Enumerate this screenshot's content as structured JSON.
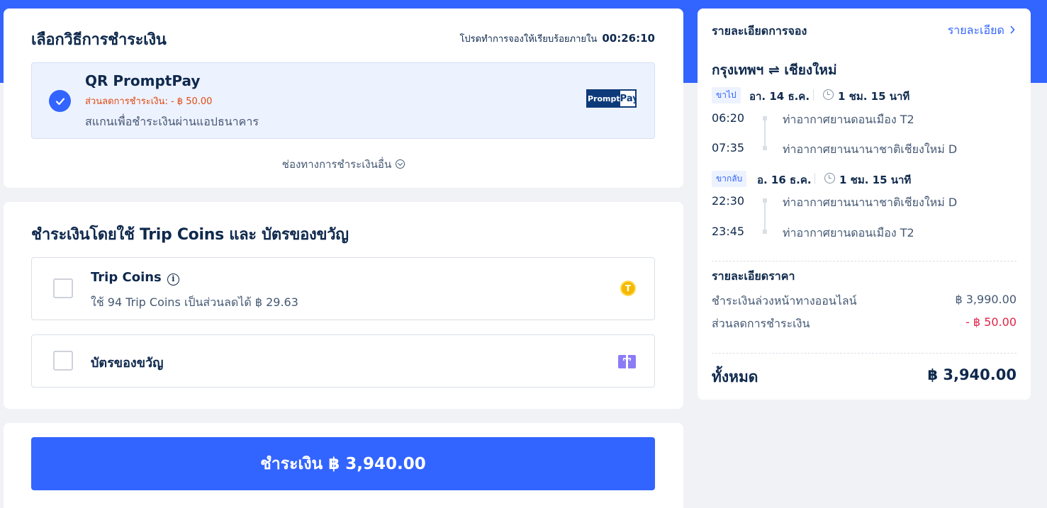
{
  "payment_section": {
    "title": "เลือกวิธีการชำระเงิน",
    "timer_text": "โปรดทำการจองให้เรียบร้อยภายใน",
    "timer_value": "00:26:10",
    "selected_method": {
      "name": "QR PromptPay",
      "discount": "ส่วนลดการชำระเงิน: - ฿ 50.00",
      "description": "สแกนเพื่อชำระเงินผ่านแอปธนาคาร",
      "logo_text_a": "Prompt",
      "logo_text_b": "Pay"
    },
    "more_methods_label": "ช่องทางการชำระเงินอื่น"
  },
  "coins_section": {
    "title": "ชำระเงินโดยใช้ Trip Coins และ บัตรของขวัญ",
    "trip_coins": {
      "title": "Trip Coins",
      "info_glyph": "i",
      "subtitle": "ใช้ 94 Trip Coins เป็นส่วนลดได้ ฿ 29.63",
      "coin_glyph": "T"
    },
    "gift_card": {
      "title": "บัตรของขวัญ"
    }
  },
  "pay_button": {
    "label": "ชำระเงิน ฿ 3,940.00"
  },
  "summary": {
    "title": "รายละเอียดการจอง",
    "details_link": "รายละเอียด",
    "route": "กรุงเทพฯ ⇌ เชียงใหม่",
    "outbound": {
      "tag": "ขาไป",
      "date": "อา. 14 ธ.ค.",
      "duration": "1 ชม. 15 นาที",
      "dep_time": "06:20",
      "dep_airport": "ท่าอากาศยานดอนเมือง T2",
      "arr_time": "07:35",
      "arr_airport": "ท่าอากาศยานนานาชาติเชียงใหม่ D"
    },
    "return": {
      "tag": "ขากลับ",
      "date": "อ. 16 ธ.ค.",
      "duration": "1 ชม. 15 นาที",
      "dep_time": "22:30",
      "dep_airport": "ท่าอากาศยานนานาชาติเชียงใหม่ D",
      "arr_time": "23:45",
      "arr_airport": "ท่าอากาศยานดอนเมือง T2"
    },
    "price": {
      "title": "รายละเอียดราคา",
      "online_label": "ชำระเงินล่วงหน้าทางออนไลน์",
      "online_value": "฿ 3,990.00",
      "discount_label": "ส่วนลดการชำระเงิน",
      "discount_value": "- ฿ 50.00",
      "total_label": "ทั้งหมด",
      "total_value": "฿ 3,940.00"
    }
  },
  "colors": {
    "brand_blue": "#3264ff",
    "discount_orange": "#e04a10",
    "negative_red": "#e0244a",
    "text_dark": "#0f294d"
  }
}
